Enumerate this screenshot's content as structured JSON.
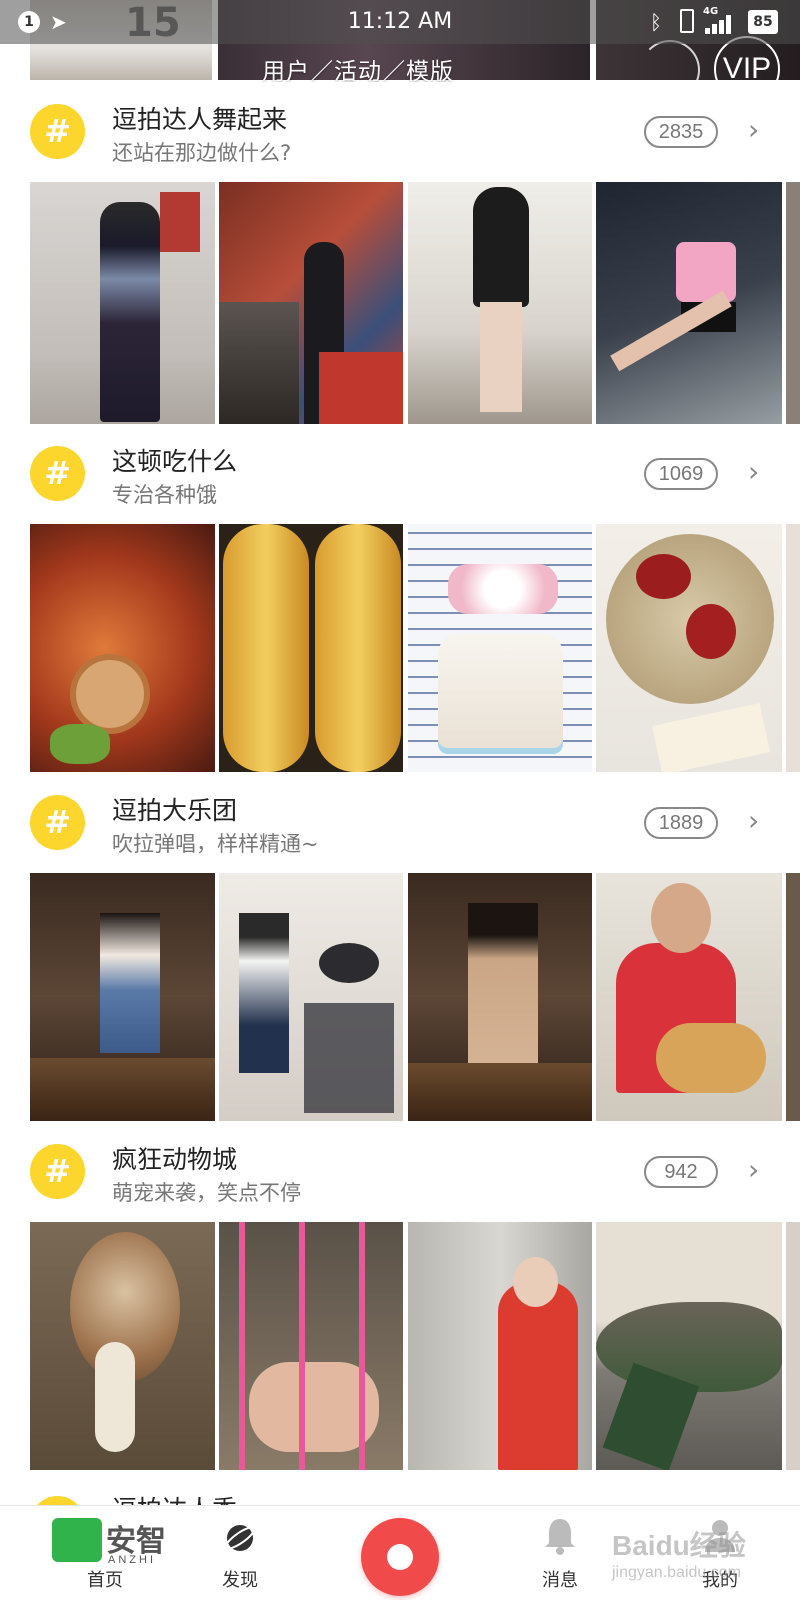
{
  "status_bar": {
    "notification_count": "1",
    "time": "11:12 AM",
    "network": "4G",
    "battery": "85"
  },
  "top": {
    "jersey_number": "15",
    "tabs_text": "用户／活动／模版",
    "vip_label": "VIP"
  },
  "sections": [
    {
      "title": "逗拍达人舞起来",
      "subtitle": "还站在那边做什么?",
      "count": "2835"
    },
    {
      "title": "这顿吃什么",
      "subtitle": "专治各种饿",
      "count": "1069"
    },
    {
      "title": "逗拍大乐团",
      "subtitle": "吹拉弹唱，样样精通~",
      "count": "1889"
    },
    {
      "title": "疯狂动物城",
      "subtitle": "萌宠来袭，笑点不停",
      "count": "942"
    }
  ],
  "peek_section": {
    "title": "逗拍达人秀"
  },
  "bottom_nav": {
    "home_label": "首页",
    "discover_label": "发现",
    "messages_label": "消息",
    "me_label": "我的"
  },
  "overlay": {
    "logo_text": "安智",
    "logo_sub": "ANZHI",
    "watermark": "Baidu经验",
    "watermark_sub": "jingyan.baidu.com"
  },
  "colors": {
    "accent_yellow": "#fcd62c",
    "record_red": "#f04a4a"
  }
}
